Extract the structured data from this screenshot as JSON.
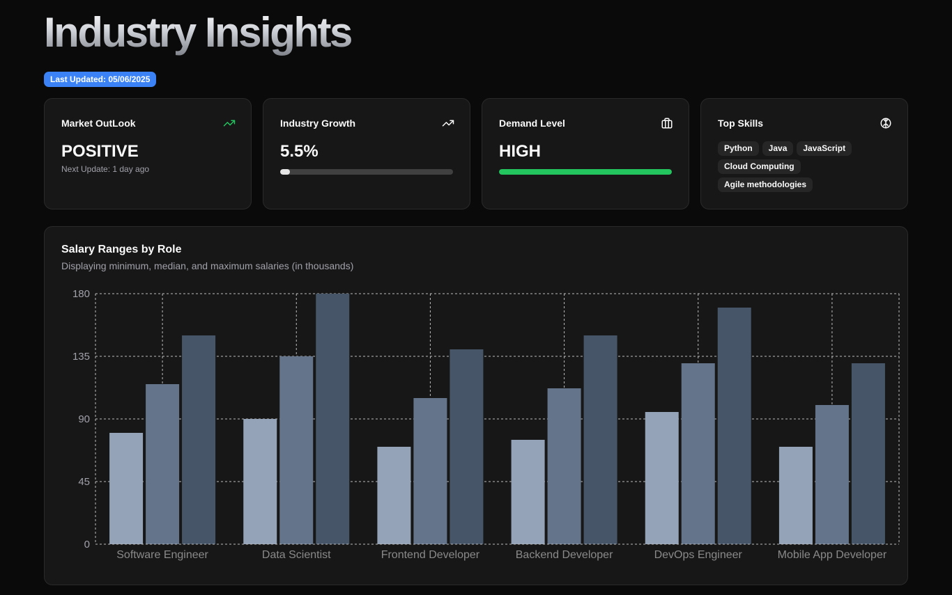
{
  "header": {
    "title": "Industry Insights",
    "last_updated": "Last Updated: 05/06/2025"
  },
  "cards": {
    "market": {
      "title": "Market OutLook",
      "value": "POSITIVE",
      "sub": "Next Update: 1 day ago",
      "icon": "trending-up-icon",
      "icon_color": "#22c55e"
    },
    "growth": {
      "title": "Industry Growth",
      "value": "5.5%",
      "progress": 0.055,
      "icon": "trending-up-icon"
    },
    "demand": {
      "title": "Demand Level",
      "value": "HIGH",
      "progress": 1.0,
      "bar_color": "#22c55e",
      "icon": "briefcase-icon"
    },
    "skills": {
      "title": "Top Skills",
      "icon": "brain-icon",
      "items": [
        "Python",
        "Java",
        "JavaScript",
        "Cloud Computing",
        "Agile methodologies"
      ]
    }
  },
  "salary_chart": {
    "title": "Salary Ranges by Role",
    "subtitle": "Displaying minimum, median, and maximum salaries (in thousands)"
  },
  "chart_data": {
    "type": "bar",
    "categories": [
      "Software Engineer",
      "Data Scientist",
      "Frontend Developer",
      "Backend Developer",
      "DevOps Engineer",
      "Mobile App Developer"
    ],
    "series": [
      {
        "values": [
          80,
          90,
          70,
          75,
          95,
          70
        ],
        "color": "#94a3b8"
      },
      {
        "values": [
          115,
          135,
          105,
          112,
          130,
          100
        ],
        "color": "#64748b"
      },
      {
        "values": [
          150,
          180,
          140,
          150,
          170,
          130
        ],
        "color": "#475569"
      }
    ],
    "yticks": [
      0,
      45,
      90,
      135,
      180
    ],
    "ylim": [
      0,
      180
    ],
    "grid": true
  }
}
